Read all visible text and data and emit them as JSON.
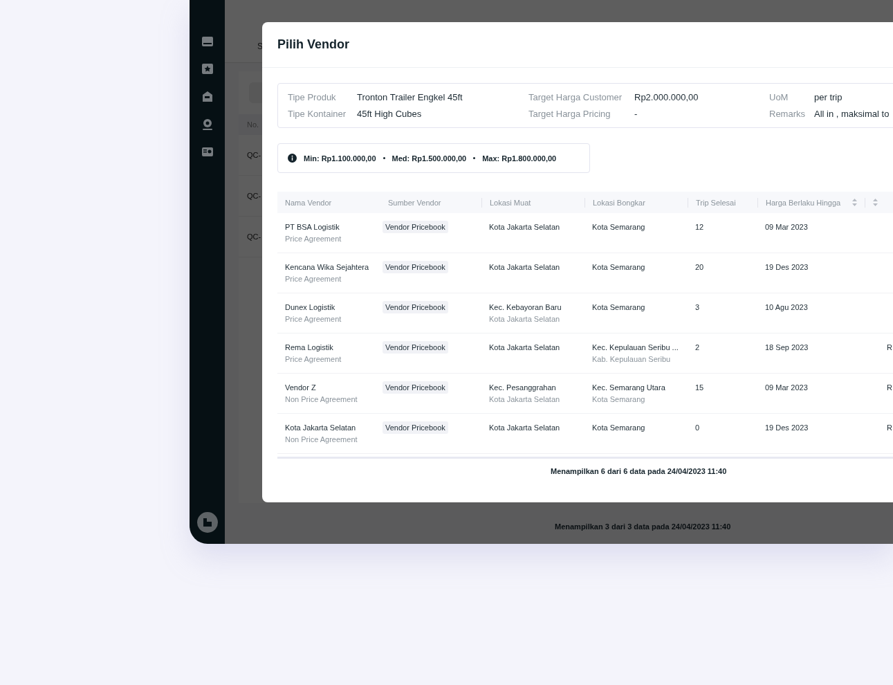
{
  "background_page": {
    "tab": "S",
    "table_header": "No.",
    "rows": [
      "QC-",
      "QC-",
      "QC-"
    ],
    "footer": "Menampilkan 3 dari 3 data pada 24/04/2023 11:40"
  },
  "modal": {
    "title": "Pilih Vendor",
    "info": [
      {
        "label": "Tipe Produk",
        "value": "Tronton Trailer Engkel 45ft"
      },
      {
        "label": "Target Harga Customer",
        "value": "Rp2.000.000,00"
      },
      {
        "label": "UoM",
        "value": "per trip"
      },
      {
        "label": "Tipe Kontainer",
        "value": "45ft High Cubes"
      },
      {
        "label": "Target Harga Pricing",
        "value": "-"
      },
      {
        "label": "Remarks",
        "value": "All in , maksimal to"
      }
    ],
    "summary": [
      {
        "label": "Min:",
        "value": "Rp1.100.000,00"
      },
      {
        "label": "Med:",
        "value": "Rp1.500.000,00"
      },
      {
        "label": "Max:",
        "value": "Rp1.800.000,00"
      }
    ],
    "columns": [
      {
        "label": "Nama Vendor",
        "sortable": false
      },
      {
        "label": "Sumber Vendor",
        "sortable": false
      },
      {
        "label": "Lokasi Muat",
        "sortable": false
      },
      {
        "label": "Lokasi Bongkar",
        "sortable": false
      },
      {
        "label": "Trip Selesai",
        "sortable": false
      },
      {
        "label": "Harga Berlaku Hingga",
        "sortable": true
      },
      {
        "sortable": true
      }
    ],
    "rows": [
      {
        "vendor": "PT BSA Logistik",
        "agreement": "Price Agreement",
        "source": "Vendor Pricebook",
        "muat": [
          "Kota Jakarta Selatan"
        ],
        "bongkar": [
          "Kota Semarang"
        ],
        "trip": "12",
        "valid_until": "09 Mar 2023"
      },
      {
        "vendor": "Kencana Wika Sejahtera",
        "agreement": "Price Agreement",
        "source": "Vendor Pricebook",
        "muat": [
          "Kota Jakarta Selatan"
        ],
        "bongkar": [
          "Kota Semarang"
        ],
        "trip": "20",
        "valid_until": "19 Des 2023"
      },
      {
        "vendor": "Dunex Logistik",
        "agreement": "Price Agreement",
        "source": "Vendor Pricebook",
        "muat": [
          "Kec. Kebayoran Baru",
          "Kota Jakarta Selatan"
        ],
        "bongkar": [
          "Kota Semarang"
        ],
        "trip": "3",
        "valid_until": "10 Agu 2023"
      },
      {
        "vendor": "Rema Logistik",
        "agreement": "Price Agreement",
        "source": "Vendor Pricebook",
        "muat": [
          "Kota Jakarta Selatan"
        ],
        "bongkar": [
          "Kec. Kepulauan Seribu ...",
          "Kab. Kepulauan Seribu"
        ],
        "trip": "2",
        "valid_until": "18 Sep 2023",
        "column_7": "R"
      },
      {
        "vendor": "Vendor Z",
        "agreement": "Non Price Agreement",
        "source": "Vendor Pricebook",
        "muat": [
          "Kec. Pesanggrahan",
          "Kota Jakarta Selatan"
        ],
        "bongkar": [
          "Kec. Semarang Utara",
          "Kota Semarang"
        ],
        "trip": "15",
        "valid_until": "09 Mar 2023",
        "column_7": "R"
      },
      {
        "vendor": "Kota Jakarta Selatan",
        "agreement": "Non Price Agreement",
        "source": "Vendor Pricebook",
        "muat": [
          "Kota Jakarta Selatan"
        ],
        "bongkar": [
          "Kota Semarang"
        ],
        "trip": "0",
        "valid_until": "19 Des 2023",
        "column_7": "R"
      }
    ],
    "footer": "Menampilkan 6 dari 6 data pada 24/04/2023 11:40"
  }
}
